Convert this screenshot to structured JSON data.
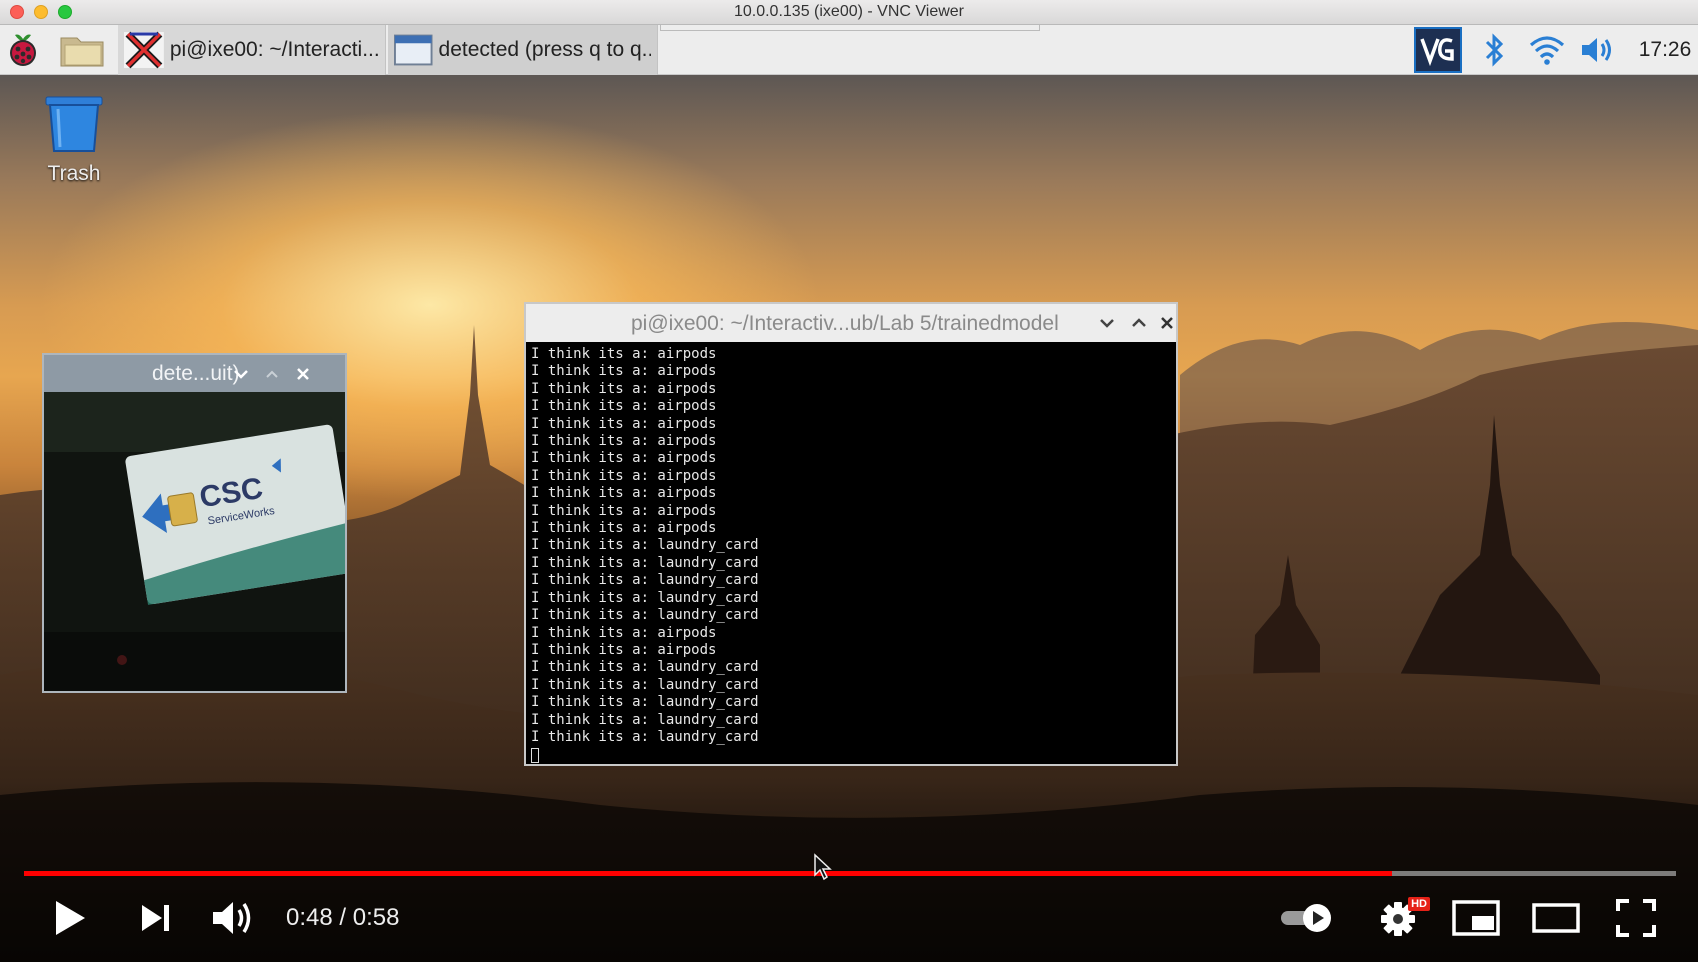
{
  "window": {
    "title": "10.0.0.135 (ixe00) - VNC Viewer"
  },
  "panel": {
    "tasks": [
      {
        "label": "pi@ixe00: ~/Interacti..."
      },
      {
        "label": "detected (press q to q..."
      }
    ],
    "clock": "17:26"
  },
  "desktop": {
    "trash_label": "Trash"
  },
  "detected_window": {
    "title": "dete...uit)"
  },
  "terminal_window": {
    "title": "pi@ixe00: ~/Interactiv...ub/Lab 5/trainedmodel",
    "lines": [
      "I think its a: airpods",
      "I think its a: airpods",
      "I think its a: airpods",
      "I think its a: airpods",
      "I think its a: airpods",
      "I think its a: airpods",
      "I think its a: airpods",
      "I think its a: airpods",
      "I think its a: airpods",
      "I think its a: airpods",
      "I think its a: airpods",
      "I think its a: laundry_card",
      "I think its a: laundry_card",
      "I think its a: laundry_card",
      "I think its a: laundry_card",
      "I think its a: laundry_card",
      "I think its a: airpods",
      "I think its a: airpods",
      "I think its a: laundry_card",
      "I think its a: laundry_card",
      "I think its a: laundry_card",
      "I think its a: laundry_card",
      "I think its a: laundry_card"
    ]
  },
  "player": {
    "time": "0:48 / 0:58",
    "progress_fraction": 0.828,
    "hd_badge": "HD",
    "accent": "#ff0000"
  },
  "icons": {
    "menu": "raspberry-icon",
    "files": "folder-icon",
    "terminal": "terminal-x-icon",
    "tray": [
      "vnc-icon",
      "bluetooth-icon",
      "wifi-icon",
      "volume-icon"
    ],
    "player": [
      "play-icon",
      "next-icon",
      "volume-icon",
      "autoplay-toggle-icon",
      "settings-gear-icon",
      "miniplayer-icon",
      "theater-icon",
      "fullscreen-icon"
    ]
  }
}
